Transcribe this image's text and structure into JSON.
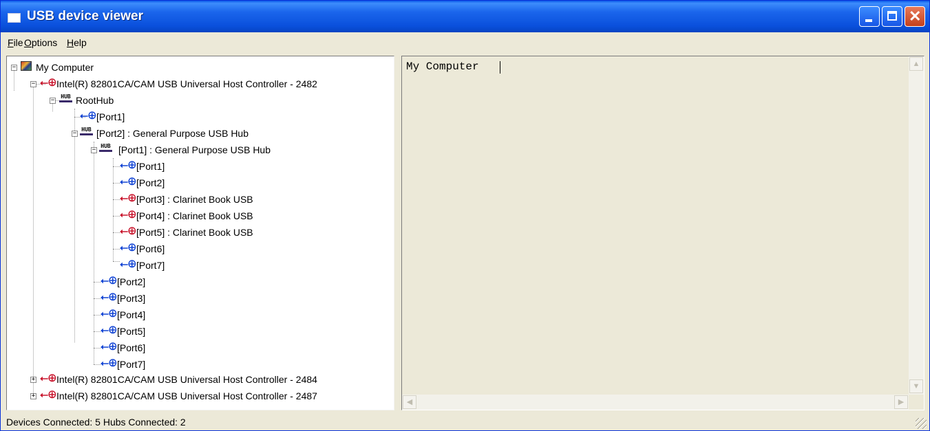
{
  "window": {
    "title": "USB device viewer"
  },
  "menu": [
    "File",
    "Options",
    "Help"
  ],
  "tree": {
    "root": "My Computer",
    "controller_1": "Intel(R) 82801CA/CAM USB Universal Host Controller - 2482",
    "roothub": "RootHub",
    "rh_port1": "[Port1]",
    "rh_port2": "[Port2]  :  General Purpose USB Hub",
    "hub_port1": "[Port1]  :  General Purpose USB Hub",
    "sub_ports": [
      "[Port1]",
      "[Port2]",
      "[Port3]  :  Clarinet Book USB",
      "[Port4]  :  Clarinet Book USB",
      "[Port5]  :  Clarinet Book USB",
      "[Port6]",
      "[Port7]"
    ],
    "hub_ports": [
      "[Port2]",
      "[Port3]",
      "[Port4]",
      "[Port5]",
      "[Port6]",
      "[Port7]"
    ],
    "controller_2": "Intel(R) 82801CA/CAM USB Universal Host Controller - 2484",
    "controller_3": "Intel(R) 82801CA/CAM USB Universal Host Controller - 2487"
  },
  "detail": {
    "text": "My Computer"
  },
  "status": {
    "text": "Devices Connected: 5   Hubs Connected: 2"
  },
  "icons": {
    "computer": "computer-icon",
    "controller": "usb-controller-icon",
    "hub": "usb-hub-icon",
    "port": "usb-port-icon",
    "device": "usb-device-icon",
    "hub_glyph": "HUB",
    "usb_glyph": "⭠⊕"
  },
  "colors": {
    "titlebar": "#0a50dc",
    "port": "#1244d4",
    "device": "#c8142c"
  }
}
